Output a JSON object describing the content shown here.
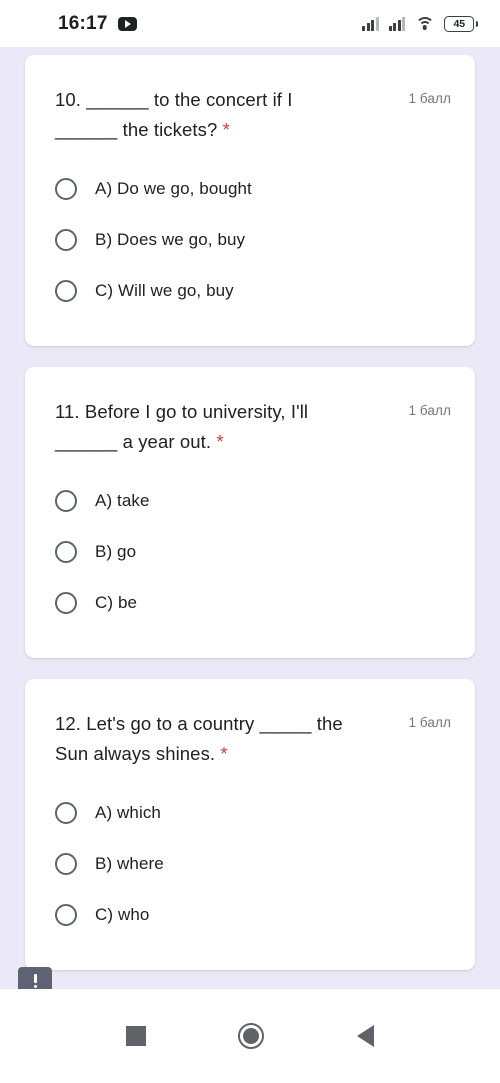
{
  "status_bar": {
    "time": "16:17",
    "app_icon": "youtube-icon",
    "signal_icon_1": "signal-bars-icon",
    "signal_icon_2": "signal-bars-icon",
    "wifi_icon": "wifi-icon",
    "battery_level": "45"
  },
  "colors": {
    "page_background": "#ebe9f7",
    "card_background": "#ffffff",
    "text_primary": "#202124",
    "text_secondary": "#70757a",
    "required_asterisk": "#c5413a",
    "radio_border": "#5f6368",
    "comment_badge": "#5f6272"
  },
  "quiz": {
    "questions": [
      {
        "text_line_1": "10. ______ to the concert if I",
        "text_line_2": "______ the tickets?",
        "required_marker": "*",
        "points": "1 балл",
        "options": [
          {
            "label": "A) Do we go, bought",
            "selected": false
          },
          {
            "label": "B) Does we go, buy",
            "selected": false
          },
          {
            "label": "C) Will we go, buy",
            "selected": false
          }
        ]
      },
      {
        "text_line_1": "11. Before I go to university, I'll",
        "text_line_2": "______ a year out.",
        "required_marker": "*",
        "points": "1 балл",
        "options": [
          {
            "label": "A) take",
            "selected": false
          },
          {
            "label": "B) go",
            "selected": false
          },
          {
            "label": "C) be",
            "selected": false
          }
        ]
      },
      {
        "text_line_1": "12. Let's go to a country _____ the",
        "text_line_2": "Sun always shines.",
        "required_marker": "*",
        "points": "1 балл",
        "options": [
          {
            "label": "A) which",
            "selected": false
          },
          {
            "label": "B) where",
            "selected": false
          },
          {
            "label": "C) who",
            "selected": false
          }
        ]
      }
    ],
    "comment_badge_icon": "comment-alert-icon"
  },
  "nav_bar": {
    "recent_icon": "recent-apps-icon",
    "home_icon": "home-icon",
    "back_icon": "back-icon"
  }
}
